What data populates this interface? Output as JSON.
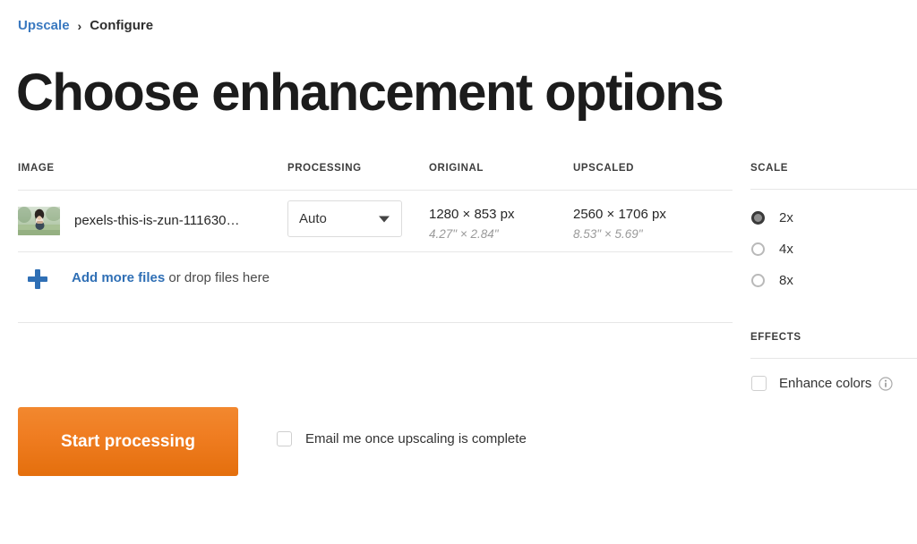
{
  "breadcrumb": {
    "link_label": "Upscale",
    "separator": "›",
    "current_label": "Configure"
  },
  "page_title": "Choose enhancement options",
  "table": {
    "headers": {
      "image": "IMAGE",
      "processing": "PROCESSING",
      "original": "ORIGINAL",
      "upscaled": "UPSCALED"
    },
    "rows": [
      {
        "file_name": "pexels-this-is-zun-111630…",
        "processing_value": "Auto",
        "original_px": "1280 × 853 px",
        "original_in": "4.27\" × 2.84\"",
        "upscaled_px": "2560 × 1706 px",
        "upscaled_in": "8.53\" × 5.69\""
      }
    ]
  },
  "add_files": {
    "link_label": "Add more files",
    "hint_label": " or drop files here"
  },
  "sidebar": {
    "scale": {
      "title": "SCALE",
      "options": [
        {
          "label": "2x",
          "selected": true
        },
        {
          "label": "4x",
          "selected": false
        },
        {
          "label": "8x",
          "selected": false
        }
      ]
    },
    "effects": {
      "title": "EFFECTS",
      "options": [
        {
          "label": "Enhance colors",
          "checked": false,
          "has_info": true
        }
      ]
    }
  },
  "actions": {
    "start_label": "Start processing",
    "email_label": "Email me once upscaling is complete",
    "email_checked": false
  },
  "colors": {
    "link_blue": "#3a79c0",
    "accent_orange": "#ef7c20",
    "text_dark": "#262626",
    "muted_gray": "#9a9a9a",
    "divider": "#e6e6e6"
  }
}
